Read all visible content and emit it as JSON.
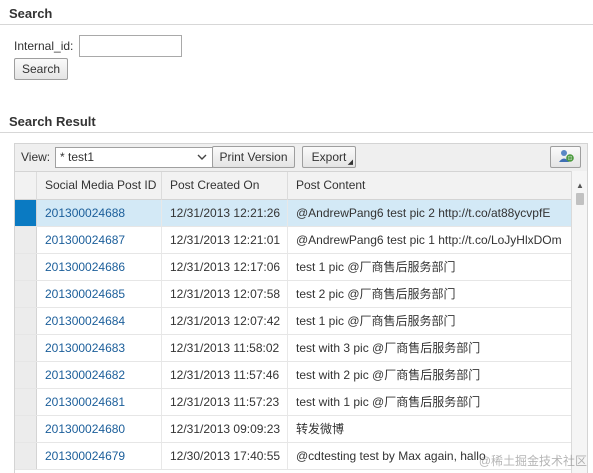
{
  "search": {
    "title": "Search",
    "internal_id_label": "Internal_id:",
    "internal_id_value": "",
    "search_button": "Search"
  },
  "result": {
    "title": "Search Result",
    "view_label": "View:",
    "view_value": "* test1",
    "print_button": "Print Version",
    "export_button": "Export",
    "settings_icon": "personalize-icon",
    "columns": {
      "id": "Social Media Post ID",
      "date": "Post Created On",
      "content": "Post Content"
    },
    "rows": [
      {
        "id": "201300024688",
        "date": "12/31/2013 12:21:26",
        "content": "@AndrewPang6 test pic 2 http://t.co/at88ycvpfE",
        "selected": true
      },
      {
        "id": "201300024687",
        "date": "12/31/2013 12:21:01",
        "content": "@AndrewPang6 test pic 1 http://t.co/LoJyHlxDOm",
        "selected": false
      },
      {
        "id": "201300024686",
        "date": "12/31/2013 12:17:06",
        "content": "test 1 pic @厂商售后服务部门",
        "selected": false
      },
      {
        "id": "201300024685",
        "date": "12/31/2013 12:07:58",
        "content": "test 2 pic @厂商售后服务部门",
        "selected": false
      },
      {
        "id": "201300024684",
        "date": "12/31/2013 12:07:42",
        "content": "test 1 pic @厂商售后服务部门",
        "selected": false
      },
      {
        "id": "201300024683",
        "date": "12/31/2013 11:58:02",
        "content": "test with 3 pic @厂商售后服务部门",
        "selected": false
      },
      {
        "id": "201300024682",
        "date": "12/31/2013 11:57:46",
        "content": "test with 2 pic @厂商售后服务部门",
        "selected": false
      },
      {
        "id": "201300024681",
        "date": "12/31/2013 11:57:23",
        "content": "test with 1 pic @厂商售后服务部门",
        "selected": false
      },
      {
        "id": "201300024680",
        "date": "12/31/2013 09:09:23",
        "content": "转发微博",
        "selected": false
      },
      {
        "id": "201300024679",
        "date": "12/30/2013 17:40:55",
        "content": "@cdtesting test by Max again, hallo",
        "selected": false
      }
    ]
  },
  "watermark": "@稀土掘金技术社区",
  "colors": {
    "link": "#1b5e9a",
    "selected_row": "#d3e9f6",
    "selected_marker": "#0a7ac2"
  }
}
